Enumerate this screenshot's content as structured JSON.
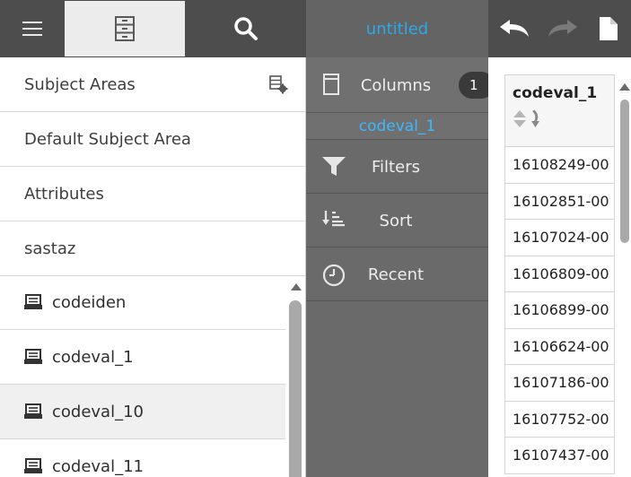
{
  "left": {
    "toolbar": {
      "menu_icon": "hamburger-icon",
      "catalog_icon": "file-cabinet-icon",
      "search_icon": "search-icon"
    },
    "nav_items": [
      {
        "label": "Subject Areas",
        "icon": "settings-icon"
      },
      {
        "label": "Default Subject Area"
      },
      {
        "label": "Attributes"
      },
      {
        "label": "sastaz"
      }
    ],
    "columns": [
      {
        "label": "codeiden",
        "icon": "table-icon"
      },
      {
        "label": "codeval_1",
        "icon": "table-icon"
      },
      {
        "label": "codeval_10",
        "icon": "table-icon",
        "selected": true
      },
      {
        "label": "codeval_11",
        "icon": "table-icon"
      }
    ]
  },
  "middle": {
    "title": "untitled",
    "columns": {
      "label": "Columns",
      "count": "1",
      "selected_column": "codeval_1",
      "icon": "column-icon"
    },
    "filters": {
      "label": "Filters",
      "icon": "filter-icon"
    },
    "sort": {
      "label": "Sort",
      "icon": "sort-icon"
    },
    "recent": {
      "label": "Recent",
      "icon": "clock-icon"
    }
  },
  "right": {
    "toolbar": {
      "undo_icon": "undo-icon",
      "redo_icon": "redo-icon",
      "new_icon": "new-document-icon"
    },
    "grid": {
      "header": "codeval_1",
      "rows": [
        "16108249-00",
        "16102851-00",
        "16107024-00",
        "16106809-00",
        "16106899-00",
        "16106624-00",
        "16107186-00",
        "16107752-00",
        "16107437-00"
      ]
    }
  },
  "colors": {
    "accent": "#2ea8e8",
    "toolbar": "#4d4d4d",
    "middle_panel": "#6a6a6a"
  }
}
